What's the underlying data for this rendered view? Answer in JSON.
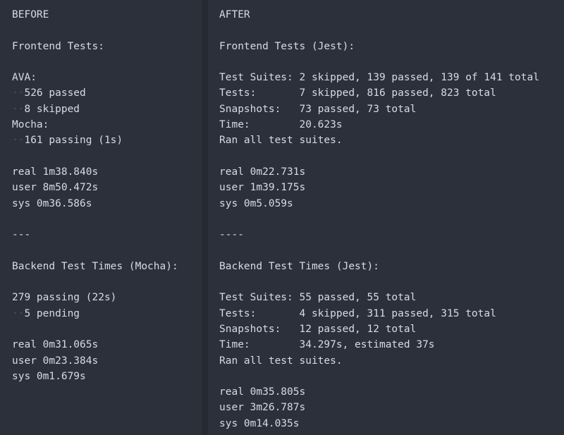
{
  "left": {
    "heading": "BEFORE",
    "frontend_title": "Frontend Tests:",
    "ava_label": "AVA:",
    "ava_passed": "526 passed",
    "ava_skipped": "8 skipped",
    "mocha_label": "Mocha:",
    "mocha_passing": "161 passing (1s)",
    "frontend_real": "real 1m38.840s",
    "frontend_user": "user 8m50.472s",
    "frontend_sys": "sys 0m36.586s",
    "separator": "---",
    "backend_title": "Backend Test Times (Mocha):",
    "backend_passing": "279 passing (22s)",
    "backend_pending": "5 pending",
    "backend_real": "real 0m31.065s",
    "backend_user": "user 0m23.384s",
    "backend_sys": "sys 0m1.679s",
    "indent_marker": "··"
  },
  "right": {
    "heading": "AFTER",
    "frontend_title": "Frontend Tests (Jest):",
    "fe_suites": "Test Suites: 2 skipped, 139 passed, 139 of 141 total",
    "fe_tests": "Tests:       7 skipped, 816 passed, 823 total",
    "fe_snapshots": "Snapshots:   73 passed, 73 total",
    "fe_time": "Time:        20.623s",
    "fe_ran": "Ran all test suites.",
    "frontend_real": "real 0m22.731s",
    "frontend_user": "user 1m39.175s",
    "frontend_sys": "sys 0m5.059s",
    "separator": "----",
    "backend_title": "Backend Test Times (Jest):",
    "be_suites": "Test Suites: 55 passed, 55 total",
    "be_tests": "Tests:       4 skipped, 311 passed, 315 total",
    "be_snapshots": "Snapshots:   12 passed, 12 total",
    "be_time": "Time:        34.297s, estimated 37s",
    "be_ran": "Ran all test suites.",
    "backend_real": "real 0m35.805s",
    "backend_user": "user 3m26.787s",
    "backend_sys": "sys 0m14.035s"
  },
  "colors": {
    "background": "#2b303b",
    "divider": "#252a33",
    "text": "#d6dbe3",
    "whitespace_marker": "#4b515c"
  }
}
